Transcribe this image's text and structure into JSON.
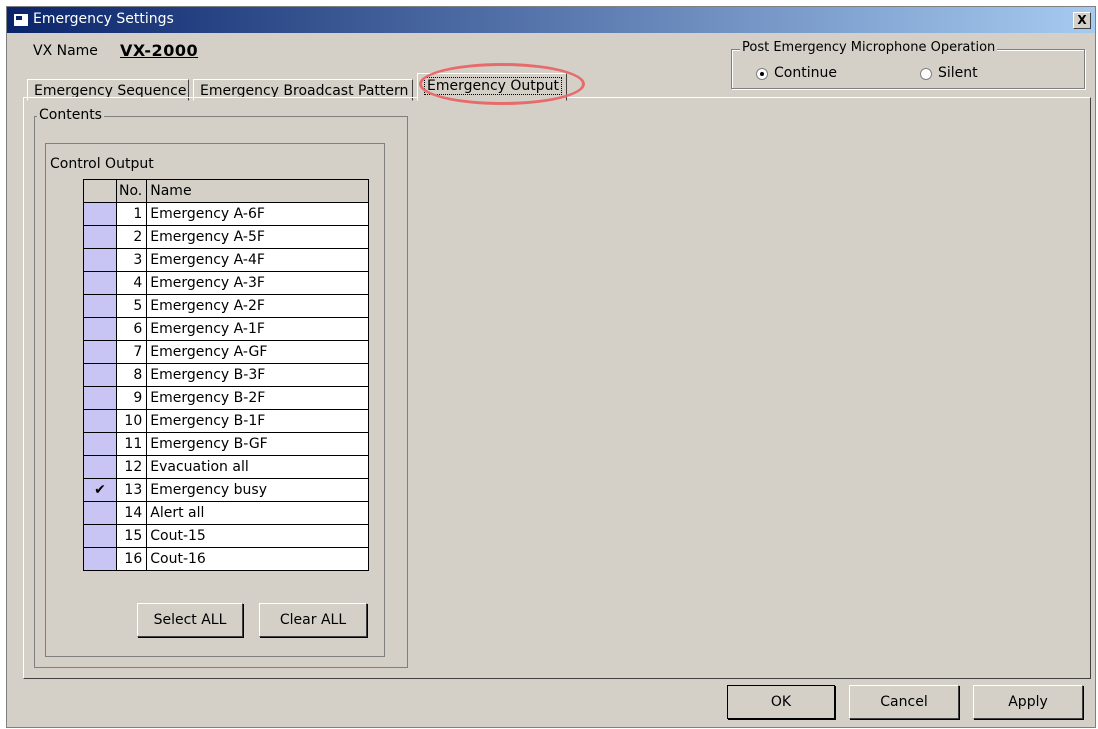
{
  "window": {
    "title": "Emergency Settings",
    "close_symbol": "X"
  },
  "vx": {
    "label": "VX Name",
    "value": "VX-2000"
  },
  "post_emergency": {
    "legend": "Post Emergency Microphone Operation",
    "options": [
      {
        "label": "Continue",
        "selected": true
      },
      {
        "label": "Silent",
        "selected": false
      }
    ]
  },
  "tabs": [
    {
      "label": "Emergency Sequence"
    },
    {
      "label": "Emergency Broadcast Pattern"
    },
    {
      "label": "Emergency Output",
      "active": true
    }
  ],
  "contents": {
    "legend": "Contents",
    "control_output": {
      "label": "Control Output",
      "columns": [
        "No.",
        "Name"
      ],
      "rows": [
        {
          "no": "1",
          "name": "Emergency A-6F",
          "checked": false
        },
        {
          "no": "2",
          "name": "Emergency A-5F",
          "checked": false
        },
        {
          "no": "3",
          "name": "Emergency A-4F",
          "checked": false
        },
        {
          "no": "4",
          "name": "Emergency A-3F",
          "checked": false
        },
        {
          "no": "5",
          "name": "Emergency A-2F",
          "checked": false
        },
        {
          "no": "6",
          "name": "Emergency A-1F",
          "checked": false
        },
        {
          "no": "7",
          "name": "Emergency A-GF",
          "checked": false
        },
        {
          "no": "8",
          "name": "Emergency B-3F",
          "checked": false
        },
        {
          "no": "9",
          "name": "Emergency B-2F",
          "checked": false
        },
        {
          "no": "10",
          "name": "Emergency B-1F",
          "checked": false
        },
        {
          "no": "11",
          "name": "Emergency B-GF",
          "checked": false
        },
        {
          "no": "12",
          "name": "Evacuation all",
          "checked": false
        },
        {
          "no": "13",
          "name": "Emergency busy",
          "checked": true
        },
        {
          "no": "14",
          "name": "Alert all",
          "checked": false
        },
        {
          "no": "15",
          "name": "Cout-15",
          "checked": false
        },
        {
          "no": "16",
          "name": "Cout-16",
          "checked": false
        }
      ],
      "select_all_label": "Select ALL",
      "clear_all_label": "Clear ALL"
    }
  },
  "footer": {
    "ok_label": "OK",
    "cancel_label": "Cancel",
    "apply_label": "Apply"
  },
  "colors": {
    "checkbox_cell": "#c8c4f4",
    "highlight": "#e86b6b",
    "dialog_bg": "#d4d0c8"
  },
  "icons": {
    "check": "✔"
  }
}
